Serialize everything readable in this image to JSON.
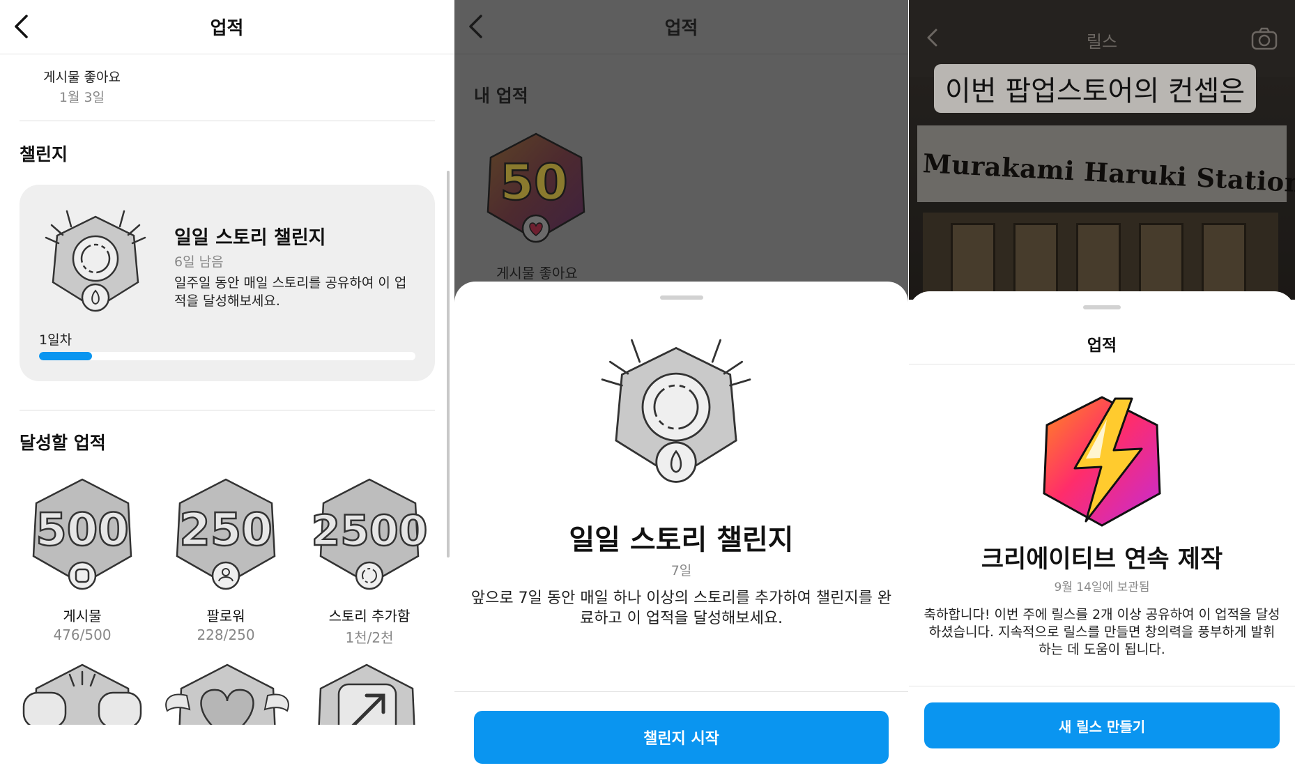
{
  "panel1": {
    "nav": {
      "title": "업적",
      "back_icon": "chevron-left-icon"
    },
    "liked": {
      "name": "게시물 좋아요",
      "date": "1월 3일"
    },
    "challenge_section": {
      "title": "챌린지",
      "card": {
        "title": "일일 스토리 챌린지",
        "remaining": "6일 남음",
        "description": "일주일 동안 매일 스토리를 공유하여 이 업적을 달성해보세요.",
        "day_label": "1일차",
        "progress_fraction": 0.14,
        "progress_color": "#0a95f0"
      }
    },
    "achievements_section": {
      "title": "달성할 업적",
      "items": [
        {
          "badge_number": "500",
          "name": "게시물",
          "current": "476",
          "target": "/500"
        },
        {
          "badge_number": "250",
          "name": "팔로워",
          "current": "228",
          "target": "/250"
        },
        {
          "badge_number": "2500",
          "name": "스토리 추가함",
          "current": "1천",
          "target": "/2천"
        }
      ]
    }
  },
  "panel2": {
    "nav": {
      "title": "업적"
    },
    "my_achievements_title": "내 업적",
    "earned_badge": {
      "number": "50",
      "label": "게시물 좋아요"
    },
    "sheet": {
      "title": "일일 스토리 챌린지",
      "subtitle": "7일",
      "description": "앞으로 7일 동안 매일 하나 이상의 스토리를 추가하여 챌린지를 완료하고 이 업적을 달성해보세요.",
      "button": "챌린지 시작"
    }
  },
  "panel3": {
    "background": {
      "title": "릴스",
      "caption": "이번 팝업스토어의 컨셉은",
      "sign_text": "Murakami Haruki Station"
    },
    "sheet": {
      "header": "업적",
      "title": "크리에이티브 연속 제작",
      "subtitle": "9월 14일에 보관됨",
      "description": "축하합니다! 이번 주에 릴스를 2개 이상 공유하여 이 업적을 달성하셨습니다. 지속적으로 릴스를 만들면 창의력을 풍부하게 발휘하는 데 도움이 됩니다.",
      "button": "새 릴스 만들기"
    }
  },
  "colors": {
    "accent_blue": "#0a95f0",
    "badge_gray": "#bdbdbd",
    "dim_overlay": "#5e5e5e"
  }
}
